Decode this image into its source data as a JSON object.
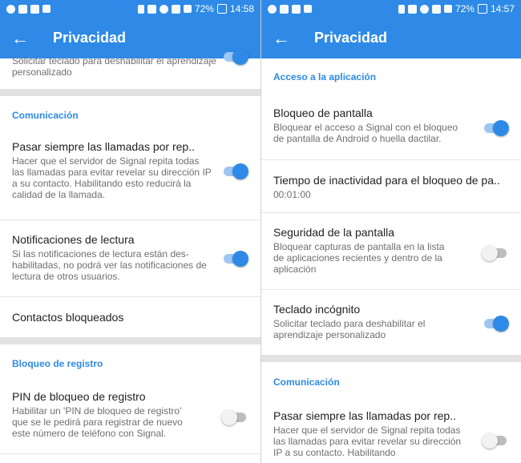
{
  "left": {
    "status": {
      "battery": "72%",
      "time": "14:58"
    },
    "title": "Privacidad",
    "partial_summary": "Solicitar teclado para deshabilitar el aprendizaje personalizado",
    "sections": [
      {
        "header": "Comunicación"
      },
      {
        "header": "Bloqueo de registro"
      }
    ],
    "items": [
      {
        "title": "Pasar siempre las llamadas por rep..",
        "summary": "Hacer que el servidor de Signal repita todas las llamadas para evitar revelar su dirección IP a su contacto. Habilitando esto reducirá la calidad de la llamada.",
        "toggle": "on"
      },
      {
        "title": "Notificaciones de lectura",
        "summary": "Si las notificaciones de lectura están des-habilitadas, no podrá ver las notificaciones de lectura de otros usuarios.",
        "toggle": "on"
      },
      {
        "title": "Contactos bloqueados"
      },
      {
        "title": "PIN de bloqueo de registro",
        "summary": "Habilitar un 'PIN de bloqueo de registro' que se le pedirá para registrar de nuevo este número de teléfono con Signal.",
        "toggle": "off"
      }
    ]
  },
  "right": {
    "status": {
      "battery": "72%",
      "time": "14:57"
    },
    "title": "Privacidad",
    "sections": [
      {
        "header": "Acceso a la aplicación"
      },
      {
        "header": "Comunicación"
      }
    ],
    "items": [
      {
        "title": "Bloqueo de pantalla",
        "summary": "Bloquear el acceso a Signal con el bloqueo de pantalla de Android o huella dactilar.",
        "toggle": "on"
      },
      {
        "title": "Tiempo de inactividad para el bloqueo de pa..",
        "summary": "00:01:00"
      },
      {
        "title": "Seguridad de la pantalla",
        "summary": "Bloquear capturas de pantalla en la lista de aplicaciones recientes y dentro de la aplicación",
        "toggle": "off"
      },
      {
        "title": "Teclado incógnito",
        "summary": "Solicitar teclado para deshabilitar el aprendizaje personalizado",
        "toggle": "on"
      },
      {
        "title": "Pasar siempre las llamadas por rep..",
        "summary": "Hacer que el servidor de Signal repita todas las llamadas para evitar revelar su dirección IP a su contacto. Habilitando",
        "toggle": "off"
      }
    ]
  },
  "colors": {
    "primary": "#2e8ae6",
    "toggle_track_on": "#9dc6f2",
    "toggle_off": "#bdbdbd"
  }
}
